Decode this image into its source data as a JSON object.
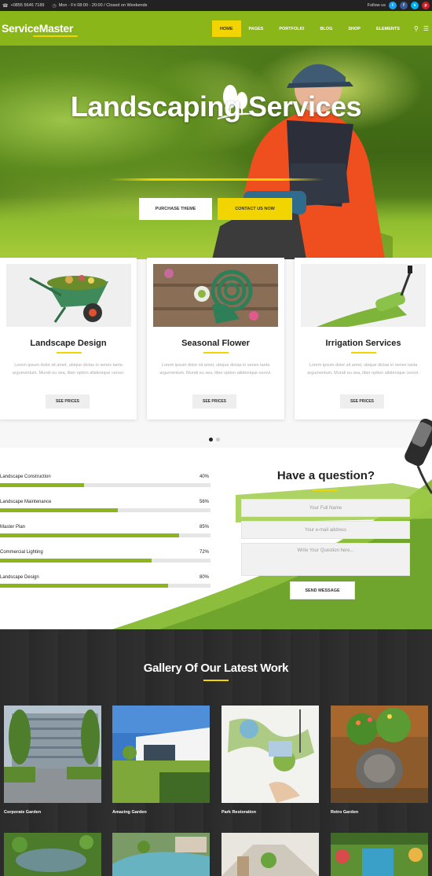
{
  "topbar": {
    "phone": "+0855 5646 7189",
    "hours": "Mon - Fri 08:00 - 20:00 / Closed on Weekends",
    "follow_label": "Follow us",
    "social": [
      {
        "icon": "twitter-icon",
        "glyph": "t",
        "color": "#1da1f2"
      },
      {
        "icon": "facebook-icon",
        "glyph": "f",
        "color": "#3b5998"
      },
      {
        "icon": "skype-icon",
        "glyph": "s",
        "color": "#00aff0"
      },
      {
        "icon": "pinterest-icon",
        "glyph": "p",
        "color": "#cb2027"
      }
    ]
  },
  "header": {
    "logo": "ServiceMaster",
    "nav": [
      "HOME",
      "PAGES",
      "PORTFOLIO",
      "BLOG",
      "SHOP",
      "ELEMENTS"
    ],
    "active_nav": "HOME",
    "icons": [
      "search-icon",
      "menu-icon"
    ]
  },
  "hero": {
    "title": "Landscaping Services",
    "btn_purchase": "PURCHASE THEME",
    "btn_contact": "CONTACT US NOW"
  },
  "services": [
    {
      "title": "Landscape Design",
      "desc": "Lorem ipsum dolor sit amet, ubique dictas in senex tanta argumentum. Mundi eu sea, liber option aliidenique cerovi.",
      "cta": "SEE PRICES"
    },
    {
      "title": "Seasonal Flower",
      "desc": "Lorem ipsum dolor sit amet, ubique dictas in senex tanta argumentum. Mundi eu sea, liber option aliidenique cerovi.",
      "cta": "SEE PRICES"
    },
    {
      "title": "Irrigation Services",
      "desc": "Lorem ipsum dolor sit amet, ubique dictas in senex tanta argumentum. Mundi eu sea, liber option aliidenique cerovi.",
      "cta": "SEE PRICES"
    }
  ],
  "skills": [
    {
      "name": "Landscape Construction",
      "value": "40%",
      "pct": 40
    },
    {
      "name": "Landscape Maintenance",
      "value": "56%",
      "pct": 56
    },
    {
      "name": "Master Plan",
      "value": "85%",
      "pct": 85
    },
    {
      "name": "Commercial Lighting",
      "value": "72%",
      "pct": 72
    },
    {
      "name": "Landscape Design",
      "value": "80%",
      "pct": 80
    }
  ],
  "question": {
    "title": "Have a question?",
    "name_placeholder": "Your Full Name",
    "email_placeholder": "Your e-mail address",
    "message_placeholder": "Write Your Question here...",
    "send": "SEND MESSAGE"
  },
  "gallery": {
    "title": "Gallery Of Our Latest Work",
    "items": [
      {
        "label": "Corporate Garden"
      },
      {
        "label": "Amazing Garden"
      },
      {
        "label": "Park Restoration"
      },
      {
        "label": "Retro Garden"
      }
    ]
  },
  "colors": {
    "accent": "#8bb619",
    "highlight": "#f2d400",
    "dark": "#2b2b2b"
  }
}
